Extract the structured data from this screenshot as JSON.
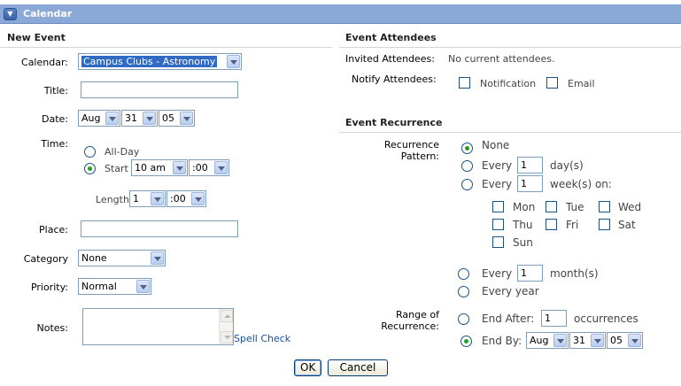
{
  "window": {
    "title": "Calendar"
  },
  "new_event": {
    "heading": "New Event",
    "calendar_label": "Calendar:",
    "calendar_value": "Campus Clubs - Astronomy",
    "title_label": "Title:",
    "title_value": "",
    "date_label": "Date:",
    "date_month": "Aug",
    "date_day": "31",
    "date_year": "05",
    "time_label": "Time:",
    "allday_label": "All-Day",
    "start_label": "Start",
    "start_hour": "10 am",
    "start_min": ":00",
    "length_label": "Length",
    "length_hours": "1",
    "length_min": ":00",
    "place_label": "Place:",
    "place_value": "",
    "category_label": "Category",
    "category_value": "None",
    "priority_label": "Priority:",
    "priority_value": "Normal",
    "notes_label": "Notes:",
    "spell_check": "Spell Check"
  },
  "attendees": {
    "heading": "Event Attendees",
    "invited_label": "Invited Attendees:",
    "invited_value": "No current attendees.",
    "notify_label": "Notify Attendees:",
    "notification_label": "Notification",
    "email_label": "Email"
  },
  "recurrence": {
    "heading": "Event Recurrence",
    "pattern_label_1": "Recurrence",
    "pattern_label_2": "Pattern:",
    "none_label": "None",
    "every_label": "Every",
    "every_days_value": "1",
    "days_unit": "day(s)",
    "every_weeks_value": "1",
    "weeks_unit": "week(s) on:",
    "days": {
      "mon": "Mon",
      "tue": "Tue",
      "wed": "Wed",
      "thu": "Thu",
      "fri": "Fri",
      "sat": "Sat",
      "sun": "Sun"
    },
    "every_months_value": "1",
    "months_unit": "month(s)",
    "every_year_label": "Every year",
    "range_label_1": "Range of",
    "range_label_2": "Recurrence:",
    "end_after_label": "End After:",
    "end_after_value": "1",
    "occurrences_label": "occurrences",
    "end_by_label": "End By:",
    "end_by_month": "Aug",
    "end_by_day": "31",
    "end_by_year": "05"
  },
  "footer": {
    "ok": "OK",
    "cancel": "Cancel"
  }
}
